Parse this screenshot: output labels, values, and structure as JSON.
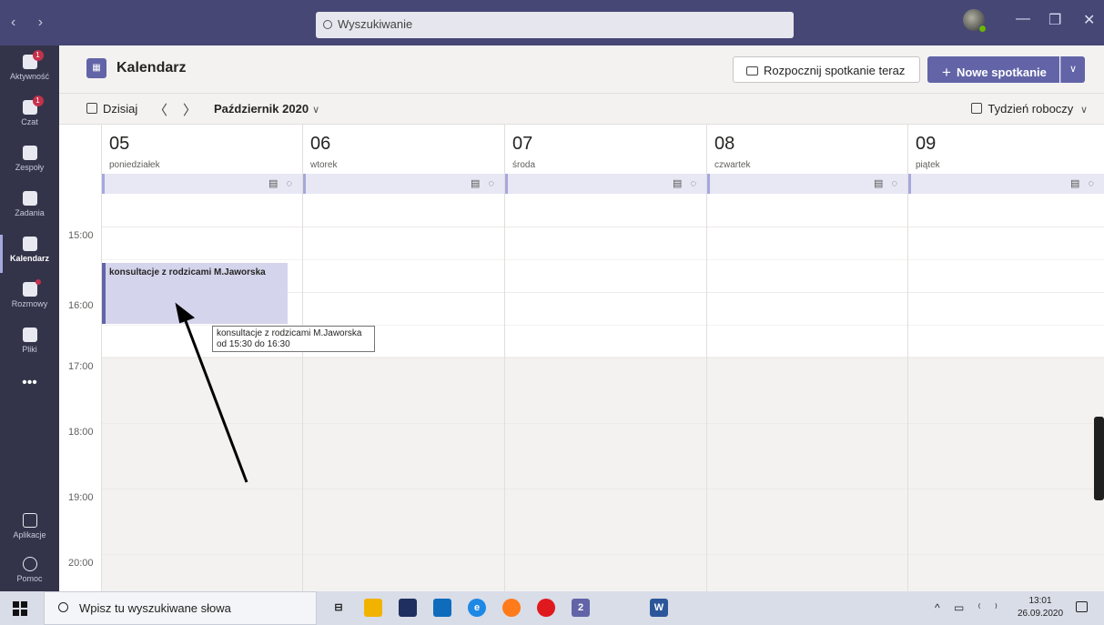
{
  "titlebar": {
    "nav": "‹ ›",
    "search_placeholder": "Wyszukiwanie",
    "min": "—",
    "max": "❐",
    "close": "✕"
  },
  "rail": {
    "items": [
      {
        "label": "Aktywność",
        "icon": "bell-icon",
        "badge": "1"
      },
      {
        "label": "Czat",
        "icon": "chat-icon",
        "badge": "1"
      },
      {
        "label": "Zespoły",
        "icon": "teams-icon"
      },
      {
        "label": "Zadania",
        "icon": "tasks-icon"
      },
      {
        "label": "Kalendarz",
        "icon": "calendar-icon"
      },
      {
        "label": "Rozmowy",
        "icon": "phone-icon"
      },
      {
        "label": "Pliki",
        "icon": "file-icon"
      }
    ],
    "more": "•••",
    "apps_label": "Aplikacje",
    "help_label": "Pomoc"
  },
  "header": {
    "title": "Kalendarz",
    "meet_now": "Rozpocznij spotkanie teraz",
    "new_meeting": "Nowe spotkanie",
    "plus": "+",
    "dropdown": "∨"
  },
  "toolbar": {
    "today": "Dzisiaj",
    "prev": "〈",
    "next": "〉",
    "month": "Październik 2020",
    "view": "Tydzień roboczy"
  },
  "days": [
    {
      "num": "05",
      "name": "poniedziałek"
    },
    {
      "num": "06",
      "name": "wtorek"
    },
    {
      "num": "07",
      "name": "środa"
    },
    {
      "num": "08",
      "name": "czwartek"
    },
    {
      "num": "09",
      "name": "piątek"
    }
  ],
  "times": [
    "15:00",
    "16:00",
    "17:00",
    "18:00",
    "19:00",
    "20:00"
  ],
  "event": {
    "title": "konsultacje z rodzicami M.Jaworska",
    "tooltip_line1": "konsultacje z rodzicami M.Jaworska",
    "tooltip_line2": "od 15:30 do 16:30"
  },
  "taskbar": {
    "search_placeholder": "Wpisz tu wyszukiwane słowa",
    "teams_badge": "2",
    "tray": "^ ▭ ⁽ ⁾",
    "time": "13:01",
    "date": "26.09.2020"
  },
  "colors": {
    "accent": "#6264a7",
    "titlebar": "#464775",
    "rail": "#33344a",
    "badge": "#c4314b"
  }
}
